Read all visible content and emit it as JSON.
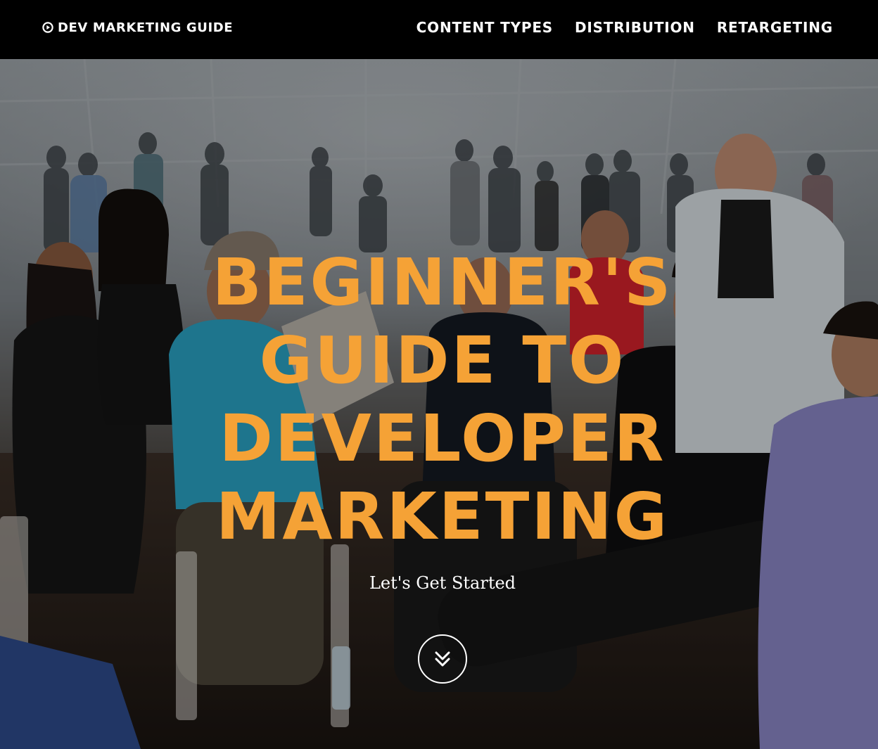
{
  "navbar": {
    "brand_label": "DEV MARKETING GUIDE",
    "brand_icon": "play-circle-icon",
    "links": [
      {
        "label": "CONTENT TYPES"
      },
      {
        "label": "DISTRIBUTION"
      },
      {
        "label": "RETARGETING"
      }
    ]
  },
  "hero": {
    "title_lines": [
      "BEGINNER'S",
      "GUIDE TO",
      "DEVELOPER",
      "MARKETING"
    ],
    "subtitle": "Let's Get Started",
    "scroll_icon": "double-chevron-down-icon"
  },
  "colors": {
    "nav_background": "#000000",
    "title_accent": "#f5a236",
    "text_light": "#ffffff"
  }
}
